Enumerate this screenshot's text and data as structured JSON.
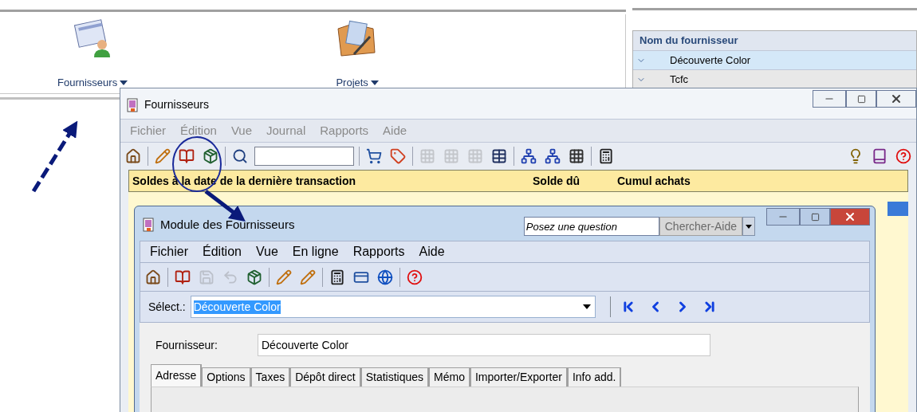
{
  "launcher": {
    "items": [
      {
        "label": "Fournisseurs",
        "kind": "suppliers"
      },
      {
        "label": "Projets",
        "kind": "projects"
      }
    ]
  },
  "supplier_list": {
    "column": "Nom du fournisseur",
    "rows": [
      {
        "name": "Découverte Color",
        "selected": true
      },
      {
        "name": "Tcfc",
        "selected": false
      }
    ]
  },
  "back_window": {
    "title": "Fournisseurs",
    "active": false,
    "menu": [
      "Fichier",
      "Édition",
      "Vue",
      "Journal",
      "Rapports",
      "Aide"
    ],
    "toolbar": [
      {
        "kind": "home",
        "disabled": false
      },
      {
        "kind": "sep"
      },
      {
        "kind": "pencil",
        "disabled": false
      },
      {
        "kind": "book",
        "disabled": false
      },
      {
        "kind": "package",
        "disabled": false
      },
      {
        "kind": "sep"
      },
      {
        "kind": "search",
        "disabled": false
      },
      {
        "kind": "field"
      },
      {
        "kind": "sep"
      },
      {
        "kind": "cart",
        "disabled": false
      },
      {
        "kind": "tag",
        "disabled": false
      },
      {
        "kind": "sep"
      },
      {
        "kind": "grid",
        "disabled": true
      },
      {
        "kind": "grid",
        "disabled": true
      },
      {
        "kind": "grid",
        "disabled": true
      },
      {
        "kind": "table",
        "disabled": false
      },
      {
        "kind": "sep"
      },
      {
        "kind": "tree",
        "disabled": false
      },
      {
        "kind": "tree",
        "disabled": false
      },
      {
        "kind": "grid",
        "disabled": false
      },
      {
        "kind": "sep"
      },
      {
        "kind": "calc",
        "disabled": false
      },
      {
        "kind": "spacer"
      },
      {
        "kind": "bulb",
        "disabled": false
      },
      {
        "kind": "bookpurple",
        "disabled": false
      },
      {
        "kind": "help",
        "disabled": false
      }
    ],
    "columns": [
      "Soldes à la date de la dernière transaction",
      "Solde dû",
      "Cumul achats"
    ]
  },
  "front_window": {
    "title": "Module des Fournisseurs",
    "active": true,
    "help_search": {
      "placeholder": "Posez une question",
      "button": "Chercher-Aide"
    },
    "menu": [
      "Fichier",
      "Édition",
      "Vue",
      "En ligne",
      "Rapports",
      "Aide"
    ],
    "toolbar": [
      {
        "kind": "home",
        "disabled": false
      },
      {
        "kind": "sep"
      },
      {
        "kind": "book",
        "disabled": false
      },
      {
        "kind": "save",
        "disabled": true
      },
      {
        "kind": "undo",
        "disabled": true
      },
      {
        "kind": "package",
        "disabled": false
      },
      {
        "kind": "sep"
      },
      {
        "kind": "pencil",
        "disabled": false
      },
      {
        "kind": "pencil",
        "disabled": false
      },
      {
        "kind": "sep"
      },
      {
        "kind": "calc",
        "disabled": false
      },
      {
        "kind": "card",
        "disabled": false
      },
      {
        "kind": "globe",
        "disabled": false
      },
      {
        "kind": "sep"
      },
      {
        "kind": "help",
        "disabled": false
      }
    ],
    "select": {
      "label": "Sélect.:",
      "value": "Découverte Color"
    },
    "field": {
      "label": "Fournisseur:",
      "value": "Découverte Color"
    },
    "tabs": [
      {
        "label": "Adresse",
        "selected": true
      },
      {
        "label": "Options",
        "selected": false
      },
      {
        "label": "Taxes",
        "selected": false
      },
      {
        "label": "Dépôt direct",
        "selected": false
      },
      {
        "label": "Statistiques",
        "selected": false
      },
      {
        "label": "Mémo",
        "selected": false
      },
      {
        "label": "Importer/Exporter",
        "selected": false
      },
      {
        "label": "Info add.",
        "selected": false
      }
    ]
  }
}
